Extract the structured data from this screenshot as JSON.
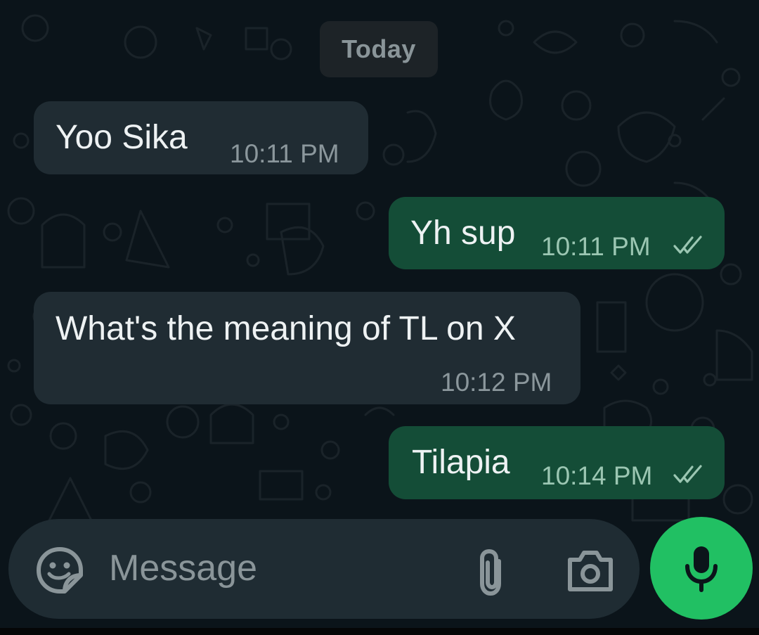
{
  "date_separator": "Today",
  "messages": [
    {
      "direction": "incoming",
      "text": "Yoo Sika",
      "time": "10:11 PM"
    },
    {
      "direction": "outgoing",
      "text": "Yh sup",
      "time": "10:11 PM",
      "status": "read"
    },
    {
      "direction": "incoming",
      "text": "What's the meaning of TL on X",
      "time": "10:12 PM"
    },
    {
      "direction": "outgoing",
      "text": "Tilapia",
      "time": "10:14 PM",
      "status": "read"
    }
  ],
  "composer": {
    "placeholder": "Message",
    "icons": [
      "sticker-icon",
      "paperclip-icon",
      "camera-icon"
    ]
  },
  "mic_button": {
    "icon": "microphone-icon"
  },
  "colors": {
    "background": "#0b141a",
    "incoming_bubble": "#202c33",
    "outgoing_bubble": "#144d37",
    "accent_green": "#21c063",
    "read_ticks": "#9bc6b2"
  }
}
